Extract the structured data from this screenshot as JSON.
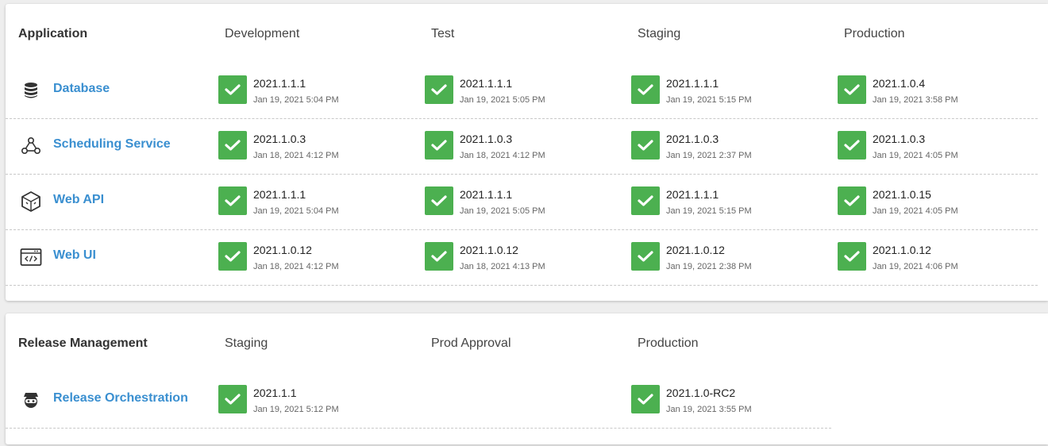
{
  "colors": {
    "success": "#4cb050",
    "link": "#3a8fd0"
  },
  "application": {
    "title": "Application",
    "environments": [
      "Development",
      "Test",
      "Staging",
      "Production"
    ],
    "rows": [
      {
        "name": "Database",
        "icon": "database-icon",
        "deployments": [
          {
            "status": "success",
            "version": "2021.1.1.1",
            "date": "Jan 19, 2021 5:04 PM"
          },
          {
            "status": "success",
            "version": "2021.1.1.1",
            "date": "Jan 19, 2021 5:05 PM"
          },
          {
            "status": "success",
            "version": "2021.1.1.1",
            "date": "Jan 19, 2021 5:15 PM"
          },
          {
            "status": "success",
            "version": "2021.1.0.4",
            "date": "Jan 19, 2021 3:58 PM"
          }
        ]
      },
      {
        "name": "Scheduling Service",
        "icon": "webhook-icon",
        "deployments": [
          {
            "status": "success",
            "version": "2021.1.0.3",
            "date": "Jan 18, 2021 4:12 PM"
          },
          {
            "status": "success",
            "version": "2021.1.0.3",
            "date": "Jan 18, 2021 4:12 PM"
          },
          {
            "status": "success",
            "version": "2021.1.0.3",
            "date": "Jan 19, 2021 2:37 PM"
          },
          {
            "status": "success",
            "version": "2021.1.0.3",
            "date": "Jan 19, 2021 4:05 PM"
          }
        ]
      },
      {
        "name": "Web API",
        "icon": "api-cube-icon",
        "deployments": [
          {
            "status": "success",
            "version": "2021.1.1.1",
            "date": "Jan 19, 2021 5:04 PM"
          },
          {
            "status": "success",
            "version": "2021.1.1.1",
            "date": "Jan 19, 2021 5:05 PM"
          },
          {
            "status": "success",
            "version": "2021.1.1.1",
            "date": "Jan 19, 2021 5:15 PM"
          },
          {
            "status": "success",
            "version": "2021.1.0.15",
            "date": "Jan 19, 2021 4:05 PM"
          }
        ]
      },
      {
        "name": "Web UI",
        "icon": "browser-code-icon",
        "deployments": [
          {
            "status": "success",
            "version": "2021.1.0.12",
            "date": "Jan 18, 2021 4:12 PM"
          },
          {
            "status": "success",
            "version": "2021.1.0.12",
            "date": "Jan 18, 2021 4:13 PM"
          },
          {
            "status": "success",
            "version": "2021.1.0.12",
            "date": "Jan 19, 2021 2:38 PM"
          },
          {
            "status": "success",
            "version": "2021.1.0.12",
            "date": "Jan 19, 2021 4:06 PM"
          }
        ]
      }
    ]
  },
  "release_management": {
    "title": "Release Management",
    "environments": [
      "Staging",
      "Prod Approval",
      "Production"
    ],
    "rows": [
      {
        "name": "Release Orchestration",
        "icon": "ninja-icon",
        "deployments": [
          {
            "status": "success",
            "version": "2021.1.1",
            "date": "Jan 19, 2021 5:12 PM"
          },
          null,
          {
            "status": "success",
            "version": "2021.1.0-RC2",
            "date": "Jan 19, 2021 3:55 PM"
          }
        ]
      }
    ]
  }
}
